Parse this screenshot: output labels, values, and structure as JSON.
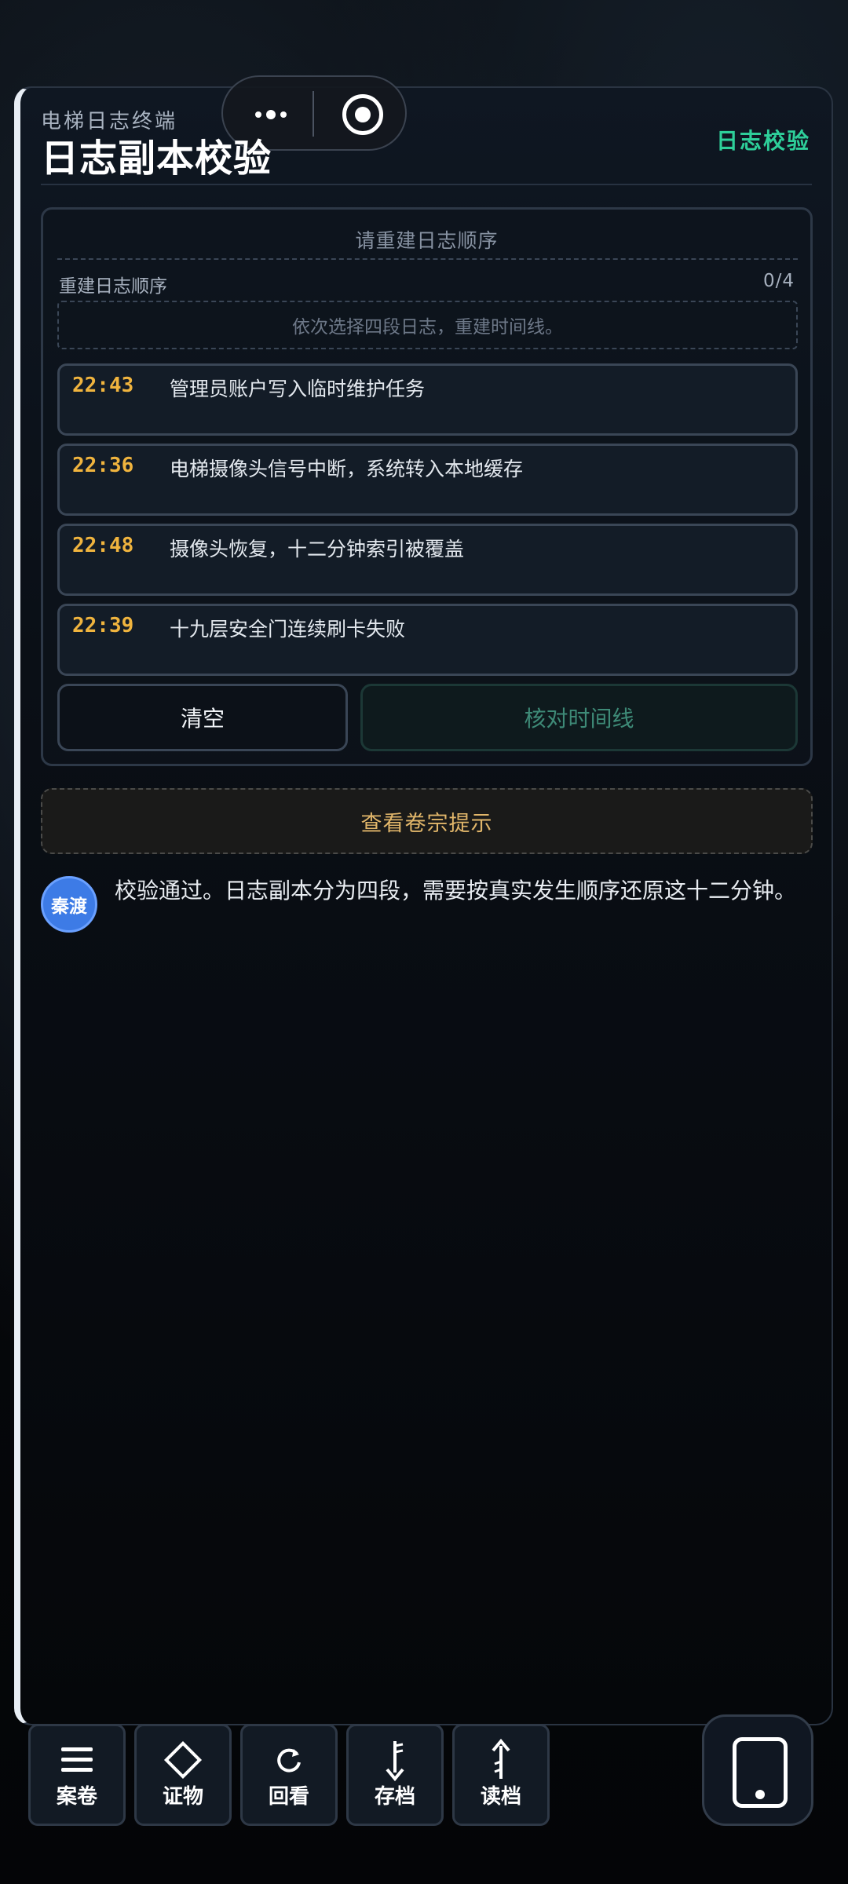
{
  "header": {
    "subtitle": "电梯日志终端",
    "title": "日志副本校验",
    "mode": "日志校验"
  },
  "puzzle": {
    "title": "请重建日志顺序",
    "order_label": "重建日志顺序",
    "order_count": "0/4",
    "slot_placeholder": "依次选择四段日志，重建时间线。",
    "logs": [
      {
        "time": "22:43",
        "text": "管理员账户写入临时维护任务"
      },
      {
        "time": "22:36",
        "text": "电梯摄像头信号中断，系统转入本地缓存"
      },
      {
        "time": "22:48",
        "text": "摄像头恢复，十二分钟索引被覆盖"
      },
      {
        "time": "22:39",
        "text": "十九层安全门连续刷卡失败"
      }
    ],
    "clear_label": "清空",
    "check_label": "核对时间线"
  },
  "hint_label": "查看卷宗提示",
  "chat": {
    "speaker": "秦渡",
    "message": "校验通过。日志副本分为四段，需要按真实发生顺序还原这十二分钟。"
  },
  "nav": [
    {
      "label": "案卷",
      "icon": "menu-icon"
    },
    {
      "label": "证物",
      "icon": "diamond-icon"
    },
    {
      "label": "回看",
      "icon": "replay-icon"
    },
    {
      "label": "存档",
      "icon": "save-icon"
    },
    {
      "label": "读档",
      "icon": "load-icon"
    }
  ],
  "phone_icon": "phone-icon"
}
